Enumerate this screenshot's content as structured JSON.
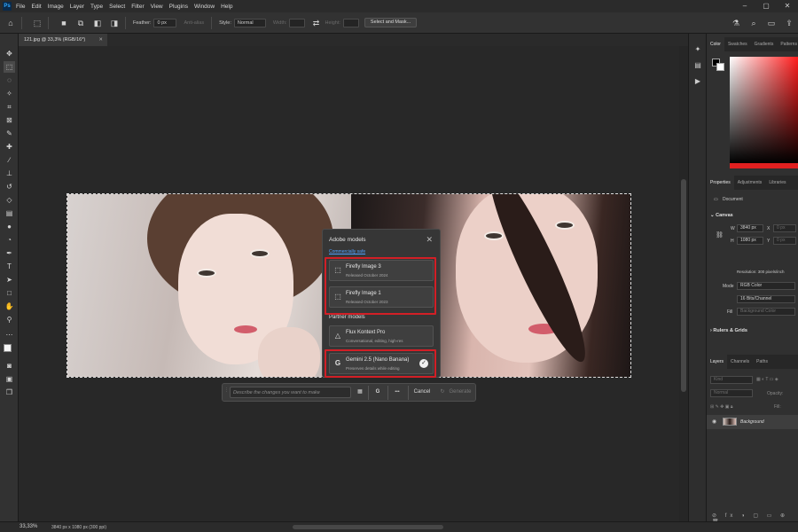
{
  "app": {
    "logo": "Ps"
  },
  "menu": [
    "File",
    "Edit",
    "Image",
    "Layer",
    "Type",
    "Select",
    "Filter",
    "View",
    "Plugins",
    "Window",
    "Help"
  ],
  "options": {
    "feather_label": "Feather:",
    "feather_value": "0 px",
    "antialias_label": "Anti-alias",
    "style_label": "Style:",
    "style_value": "Normal",
    "width_label": "Width:",
    "height_label": "Height:",
    "select_mask_label": "Select and Mask..."
  },
  "document": {
    "tab_title": "121.jpg @ 33,3% (RGB/16*)"
  },
  "model_panel": {
    "title": "Adobe models",
    "commercial_link": "Commercially safe",
    "partner_title": "Partner models",
    "models": [
      {
        "name": "Firefly Image 3",
        "subtitle": "Released October 2024"
      },
      {
        "name": "Firefly Image 1",
        "subtitle": "Released October 2023"
      },
      {
        "name": "Flux Kontext Pro",
        "subtitle": "Conversational, editing, high-res"
      },
      {
        "name": "Gemini 2.5 (Nano Banana)",
        "subtitle": "Preserves details while editing"
      }
    ]
  },
  "prompt_bar": {
    "placeholder": "Describe the changes you want to make",
    "cancel_label": "Cancel",
    "generate_label": "Generate",
    "more_label": "•••",
    "model_glyph": "G"
  },
  "color_panel": {
    "tabs": [
      "Color",
      "Swatches",
      "Gradients",
      "Patterns"
    ]
  },
  "properties_panel": {
    "tabs": [
      "Properties",
      "Adjustments",
      "Libraries"
    ],
    "document_label": "Document",
    "canvas_header": "Canvas",
    "w_label": "W",
    "h_label": "H",
    "x_label": "X",
    "y_label": "Y",
    "width_value": "3840 px",
    "height_value": "1080 px",
    "x_value": "0 px",
    "y_value": "0 px",
    "resolution": "Resolution: 300 pixels/inch",
    "mode_label": "Mode",
    "mode_value": "RGB Color",
    "depth_value": "16 Bits/Channel",
    "fill_label": "Fill",
    "fill_value": "Background Color",
    "rulers_header": "Rulers & Grids"
  },
  "layers_panel": {
    "tabs": [
      "Layers",
      "Channels",
      "Paths"
    ],
    "kind_label": "Kind",
    "blend_value": "Normal",
    "opacity_label": "Opacity:",
    "fill_label": "Fill:",
    "layer_name": "Background"
  },
  "status": {
    "zoom": "33,33%",
    "info": "3840 px x 1080 px (300 ppi)"
  },
  "colors": {
    "highlight_red": "#d21f26",
    "link_blue": "#4ea1ff"
  }
}
